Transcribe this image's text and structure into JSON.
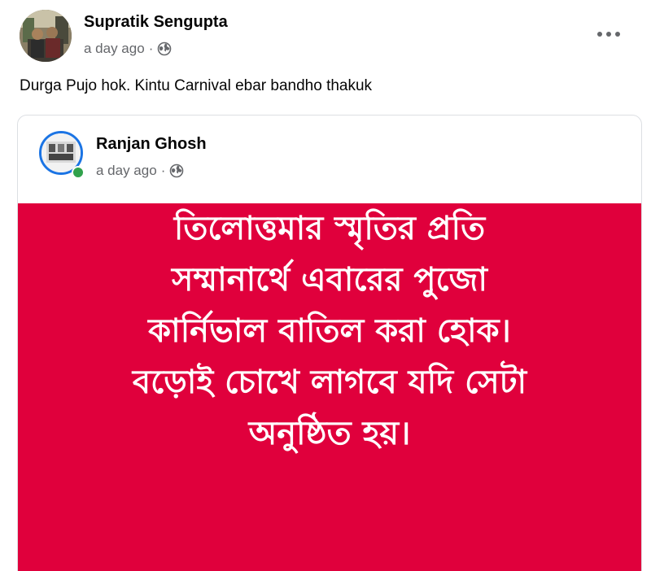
{
  "post": {
    "author": "Supratik Sengupta",
    "time": "a day ago",
    "separator": "·",
    "text": "Durga Pujo hok. Kintu Carnival ebar bandho thakuk"
  },
  "shared": {
    "author": "Ranjan Ghosh",
    "time": "a day ago",
    "separator": "·",
    "image_text": [
      "তিলোত্তমার স্মৃতির প্রতি",
      "সম্মানার্থে এবারের পুজো",
      "কার্নিভাল বাতিল করা হোক।",
      "বড়োই চোখে লাগবে যদি সেটা",
      "অনুষ্ঠিত হয়।"
    ],
    "image_background": "#e0003c"
  },
  "icons": {
    "privacy": "globe-icon",
    "more": "more-options-icon"
  }
}
